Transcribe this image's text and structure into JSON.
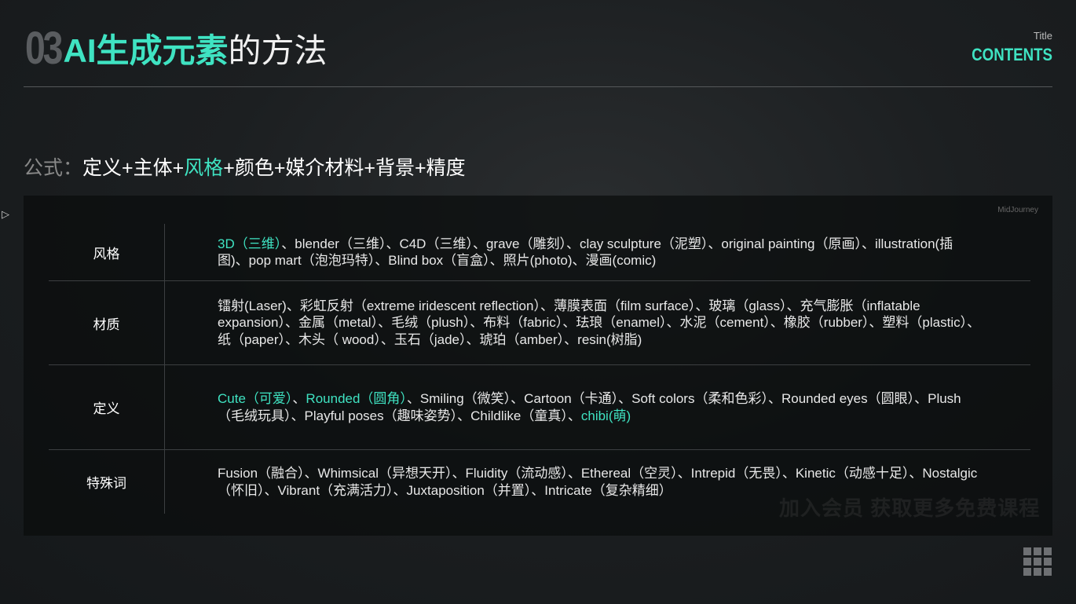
{
  "header": {
    "number": "03",
    "title_highlight": "AI生成元素",
    "title_rest": "的方法",
    "corner_small": "Title",
    "corner_big": "CONTENTS"
  },
  "formula": {
    "label": "公式：",
    "parts": [
      "定义+主体+",
      "风格",
      "+颜色+媒介材料+背景+精度"
    ]
  },
  "panel": {
    "source_label": "MidJourney",
    "watermark": "加入会员 获取更多免费课程"
  },
  "colors": {
    "accent": "#3fe3c2",
    "background": "#1c1f21"
  },
  "table": [
    {
      "label": "风格",
      "highlight": "3D（三维）",
      "text": "、blender（三维）、C4D（三维）、grave（雕刻）、clay sculpture（泥塑）、original painting（原画）、illustration(插图)、pop mart（泡泡玛特）、Blind box（盲盒）、照片(photo)、漫画(comic)"
    },
    {
      "label": "材质",
      "highlight": "",
      "text": "镭射(Laser)、彩虹反射（extreme iridescent reflection）、薄膜表面（film surface）、玻璃（glass）、充气膨胀（inflatable expansion）、金属（metal）、毛绒（plush）、布料（fabric）、珐琅（enamel）、水泥（cement）、橡胶（rubber）、塑料（plastic）、纸（paper）、木头（ wood）、玉石（jade）、琥珀（amber）、resin(树脂)"
    },
    {
      "label": "定义",
      "highlight": "Cute（可爱）",
      "sep": "、",
      "highlight2": "Rounded（圆角）",
      "text": "、Smiling（微笑）、Cartoon（卡通）、Soft colors（柔和色彩）、Rounded eyes（圆眼）、Plush（毛绒玩具）、Playful poses（趣味姿势）、Childlike（童真）、",
      "highlight3": "chibi(萌)"
    },
    {
      "label": "特殊词",
      "highlight": "",
      "text": "Fusion（融合）、Whimsical（异想天开）、Fluidity（流动感）、Ethereal（空灵）、Intrepid（无畏）、Kinetic（动感十足）、Nostalgic（怀旧）、Vibrant（充满活力）、Juxtaposition（并置）、Intricate（复杂精细）"
    }
  ]
}
